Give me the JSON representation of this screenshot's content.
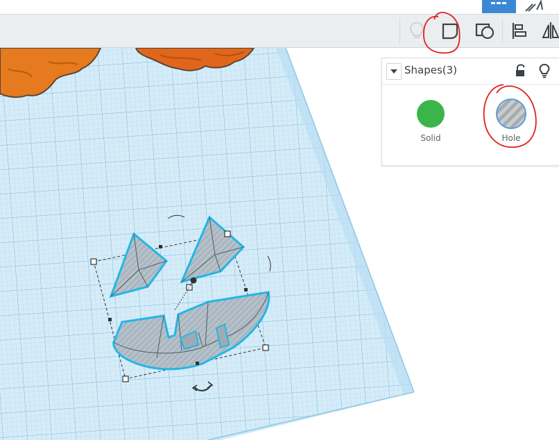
{
  "panel": {
    "title": "Shapes(3)",
    "options": [
      {
        "label": "Solid",
        "color": "#3bb54a",
        "selected": false
      },
      {
        "label": "Hole",
        "color": "#b4b8bb",
        "selected": true
      }
    ]
  },
  "colors": {
    "toolbar_bg": "#ebedef",
    "accent": "#3b88d6",
    "workplane": "#cfe8f6",
    "grid_line": "#9fcde8",
    "pumpkin": "#e3761e",
    "annotation": "#e02020"
  },
  "icons": [
    "grid-view-icon",
    "tinker-icon",
    "light-bulb-icon",
    "group-icon",
    "ungroup-icon",
    "align-icon",
    "mirror-icon",
    "collapse-icon",
    "lock-icon",
    "rotate-arrow-icon"
  ]
}
